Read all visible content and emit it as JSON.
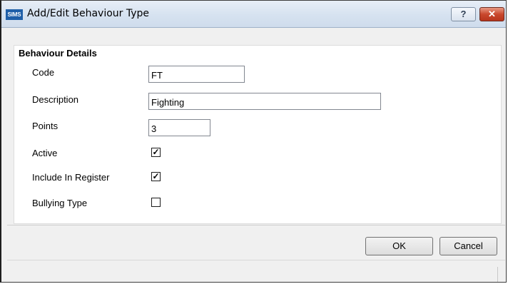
{
  "window": {
    "app_icon_text": "SIMS",
    "title": "Add/Edit Behaviour Type",
    "help_label": "?",
    "close_label": "✕"
  },
  "group": {
    "title": "Behaviour Details"
  },
  "fields": {
    "code": {
      "label": "Code",
      "value": "FT"
    },
    "description": {
      "label": "Description",
      "value": "Fighting"
    },
    "points": {
      "label": "Points",
      "value": "3"
    },
    "active": {
      "label": "Active",
      "checked": true,
      "mark": "✓"
    },
    "include_in_register": {
      "label": "Include In Register",
      "checked": true,
      "mark": "✓"
    },
    "bullying_type": {
      "label": "Bullying Type",
      "checked": false,
      "mark": ""
    }
  },
  "buttons": {
    "ok_label": "OK",
    "cancel_label": "Cancel"
  }
}
